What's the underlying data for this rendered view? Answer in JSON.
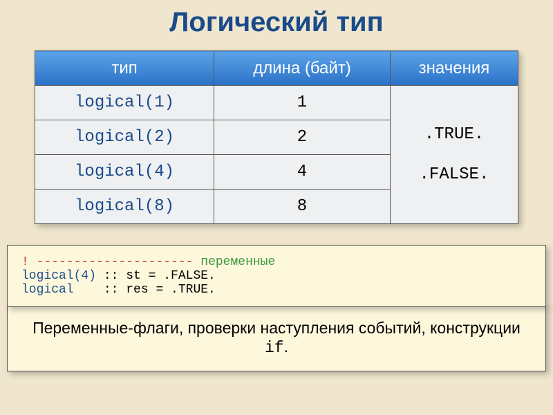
{
  "title": "Логический тип",
  "table": {
    "headers": {
      "type": "тип",
      "length": "длина (байт)",
      "values": "значения"
    },
    "rows": [
      {
        "type": "logical(1)",
        "length": "1"
      },
      {
        "type": "logical(2)",
        "length": "2"
      },
      {
        "type": "logical(4)",
        "length": "4"
      },
      {
        "type": "logical(8)",
        "length": "8"
      }
    ],
    "values_true": ".TRUE.",
    "values_false": ".FALSE."
  },
  "code": {
    "l1_bang": "!",
    "l1_dash": " --------------------- ",
    "l1_label": "переменные",
    "l2_decl": "logical(4)",
    "l2_rest": " :: st = .FALSE.",
    "l3_decl": "logical   ",
    "l3_rest": " :: res = .TRUE."
  },
  "footer": {
    "text_before": "Переменные-флаги, проверки наступления событий, конструкции ",
    "if": "if",
    "text_after": "."
  },
  "chart_data": {
    "type": "table",
    "title": "Логический тип",
    "columns": [
      "тип",
      "длина (байт)",
      "значения"
    ],
    "rows": [
      [
        "logical(1)",
        1,
        ".TRUE. / .FALSE."
      ],
      [
        "logical(2)",
        2,
        ".TRUE. / .FALSE."
      ],
      [
        "logical(4)",
        4,
        ".TRUE. / .FALSE."
      ],
      [
        "logical(8)",
        8,
        ".TRUE. / .FALSE."
      ]
    ]
  }
}
